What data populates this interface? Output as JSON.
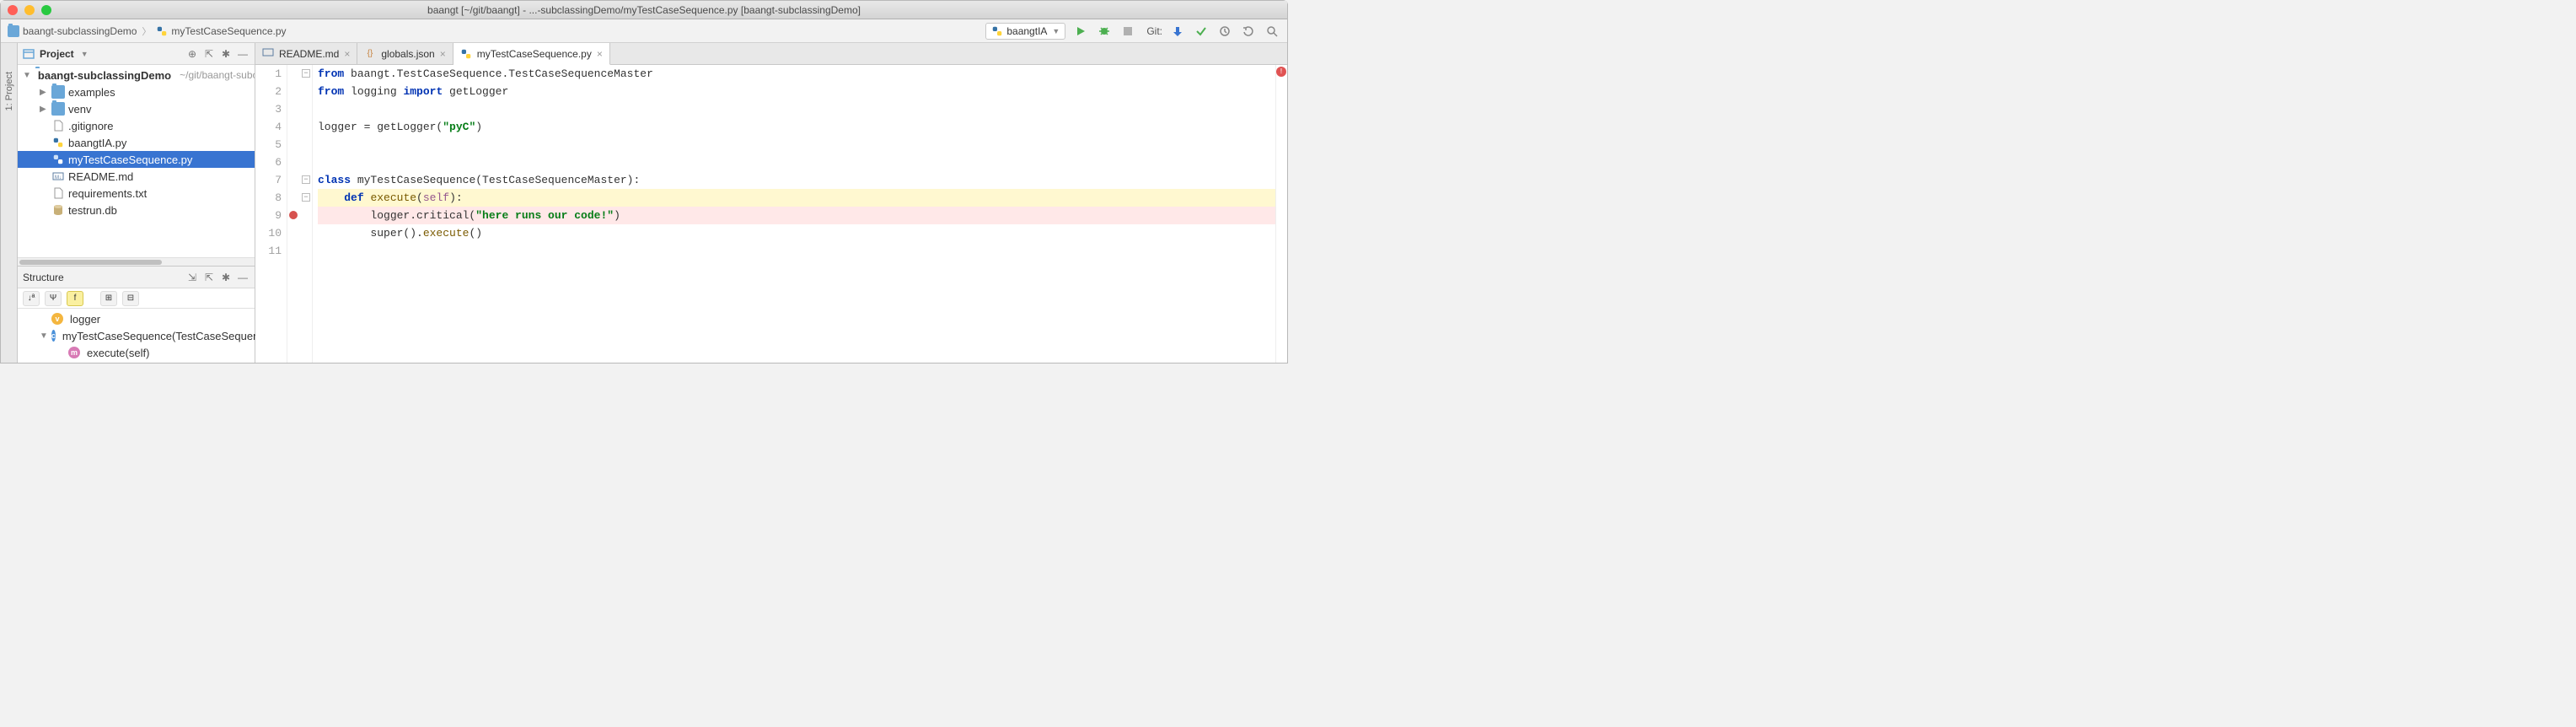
{
  "window_title": "baangt [~/git/baangt] - ...-subclassingDemo/myTestCaseSequence.py [baangt-subclassingDemo]",
  "breadcrumb": {
    "project": "baangt-subclassingDemo",
    "file": "myTestCaseSequence.py"
  },
  "run_config": "baangtIA",
  "git_label": "Git:",
  "sidebar_gutters": {
    "project": "1: Project"
  },
  "project_panel": {
    "title": "Project",
    "root": {
      "name": "baangt-subclassingDemo",
      "path": "~/git/baangt-subclassingDemo"
    },
    "items": [
      {
        "name": "examples",
        "type": "folder",
        "expandable": true
      },
      {
        "name": "venv",
        "type": "folder",
        "expandable": true
      },
      {
        "name": ".gitignore",
        "type": "file"
      },
      {
        "name": "baangtIA.py",
        "type": "python"
      },
      {
        "name": "myTestCaseSequence.py",
        "type": "python",
        "selected": true
      },
      {
        "name": "README.md",
        "type": "markdown"
      },
      {
        "name": "requirements.txt",
        "type": "text"
      },
      {
        "name": "testrun.db",
        "type": "db"
      }
    ]
  },
  "structure_panel": {
    "title": "Structure",
    "items": [
      {
        "kind": "v",
        "label": "logger"
      },
      {
        "kind": "c",
        "label": "myTestCaseSequence(TestCaseSequenceMaster)",
        "expandable": true
      },
      {
        "kind": "m",
        "label": "execute(self)",
        "indent": true
      }
    ]
  },
  "tabs": [
    {
      "label": "README.md",
      "icon": "markdown"
    },
    {
      "label": "globals.json",
      "icon": "json"
    },
    {
      "label": "myTestCaseSequence.py",
      "icon": "python",
      "active": true
    }
  ],
  "code": {
    "lines": [
      {
        "n": 1,
        "fold": "-",
        "tokens": [
          [
            "kw",
            "from"
          ],
          [
            "",
            " baangt.TestCaseSequence.TestCaseSequenceMaster"
          ]
        ]
      },
      {
        "n": 2,
        "fold": "",
        "tokens": [
          [
            "kw",
            "from"
          ],
          [
            "",
            " logging "
          ],
          [
            "kw",
            "import"
          ],
          [
            "",
            " getLogger"
          ]
        ]
      },
      {
        "n": 3,
        "tokens": [
          [
            "",
            ""
          ]
        ]
      },
      {
        "n": 4,
        "tokens": [
          [
            "",
            "logger = getLogger("
          ],
          [
            "str",
            "\"pyC\""
          ],
          [
            "",
            ")"
          ]
        ]
      },
      {
        "n": 5,
        "tokens": [
          [
            "",
            ""
          ]
        ]
      },
      {
        "n": 6,
        "fold": "",
        "tokens": [
          [
            "",
            ""
          ]
        ]
      },
      {
        "n": 7,
        "fold": "-",
        "tokens": [
          [
            "kw",
            "class"
          ],
          [
            "",
            " myTestCaseSequence(TestCaseSequenceMaster):"
          ]
        ]
      },
      {
        "n": 8,
        "hl": "yellow",
        "fold": "-",
        "tokens": [
          [
            "",
            "    "
          ],
          [
            "kw",
            "def"
          ],
          [
            "",
            " "
          ],
          [
            "call",
            "execute"
          ],
          [
            "",
            "("
          ],
          [
            "self",
            "self"
          ],
          [
            "",
            "):"
          ]
        ]
      },
      {
        "n": 9,
        "hl": "pink",
        "bp": true,
        "tokens": [
          [
            "",
            "        logger.critical("
          ],
          [
            "str",
            "\"here runs our code!\""
          ],
          [
            "",
            ")"
          ]
        ]
      },
      {
        "n": 10,
        "fold": "",
        "tokens": [
          [
            "",
            "        super()."
          ],
          [
            "call",
            "execute"
          ],
          [
            "",
            "()"
          ]
        ]
      },
      {
        "n": 11,
        "tokens": [
          [
            "",
            ""
          ]
        ]
      }
    ]
  }
}
